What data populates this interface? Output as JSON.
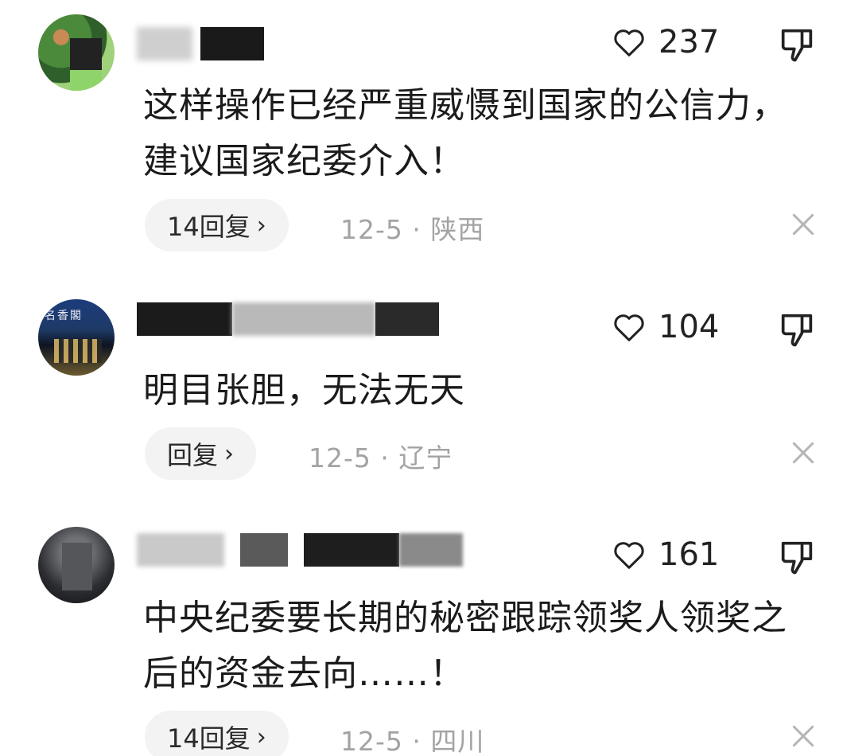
{
  "comments": [
    {
      "likes": "237",
      "text": "这样操作已经严重威慑到国家的公信力，建议国家纪委介入！",
      "reply_label": "14回复",
      "date": "12-5",
      "separator": "·",
      "location": "陕西"
    },
    {
      "likes": "104",
      "text": "明目张胆，无法无天",
      "reply_label": "回复",
      "date": "12-5",
      "separator": "·",
      "location": "辽宁"
    },
    {
      "likes": "161",
      "text": "中央纪委要长期的秘密跟踪领奖人领奖之后的资金去向……！",
      "reply_label": "14回复",
      "date": "12-5",
      "separator": "·",
      "location": "四川"
    }
  ],
  "icons": {
    "like": "heart-outline-icon",
    "dislike": "thumbs-down-icon",
    "close": "close-icon",
    "chevron": "chevron-right-icon"
  },
  "chevron_glyph": "›",
  "colors": {
    "meta_gray": "#a3a3a3",
    "pill_bg": "#f3f3f3",
    "text": "#1b1b1b"
  }
}
